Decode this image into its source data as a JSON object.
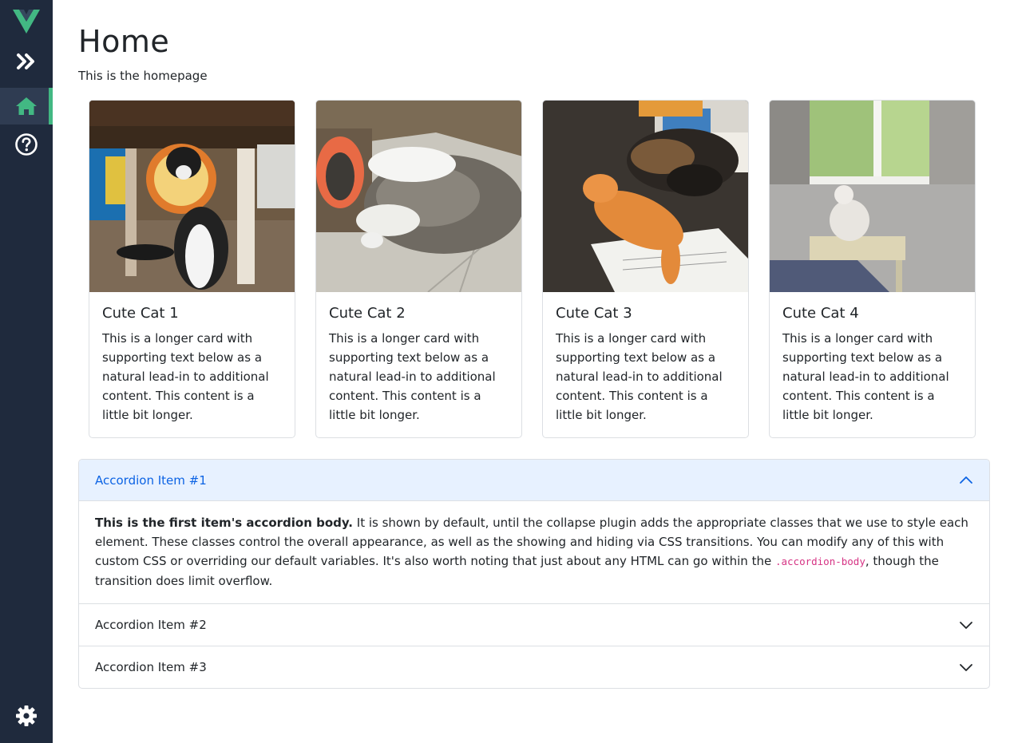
{
  "sidebar": {
    "logo": "vue-logo",
    "items": [
      {
        "icon": "double-chevron-right-icon",
        "label": "Expand"
      },
      {
        "icon": "home-icon",
        "label": "Home",
        "active": true
      },
      {
        "icon": "help-circle-icon",
        "label": "Help"
      },
      {
        "icon": "gear-icon",
        "label": "Settings"
      }
    ]
  },
  "page": {
    "title": "Home",
    "subtitle": "This is the homepage"
  },
  "cards": [
    {
      "title": "Cute Cat 1",
      "text": "This is a longer card with supporting text below as a natural lead-in to additional content. This content is a little bit longer."
    },
    {
      "title": "Cute Cat 2",
      "text": "This is a longer card with supporting text below as a natural lead-in to additional content. This content is a little bit longer."
    },
    {
      "title": "Cute Cat 3",
      "text": "This is a longer card with supporting text below as a natural lead-in to additional content. This content is a little bit longer."
    },
    {
      "title": "Cute Cat 4",
      "text": "This is a longer card with supporting text below as a natural lead-in to additional content. This content is a little bit longer."
    }
  ],
  "accordion": {
    "items": [
      {
        "label": "Accordion Item #1",
        "open": true
      },
      {
        "label": "Accordion Item #2",
        "open": false
      },
      {
        "label": "Accordion Item #3",
        "open": false
      }
    ],
    "body": {
      "strong": "This is the first item's accordion body.",
      "text_before": " It is shown by default, until the collapse plugin adds the appropriate classes that we use to style each element. These classes control the overall appearance, as well as the showing and hiding via CSS transitions. You can modify any of this with custom CSS or overriding our default variables. It's also worth noting that just about any HTML can go within the ",
      "code": ".accordion-body",
      "text_after": ", though the transition does limit overflow."
    }
  },
  "colors": {
    "sidebar_bg": "#1f2a3d",
    "accent": "#42b883",
    "accordion_active_bg": "#e7f1ff",
    "accordion_active_text": "#0c63e4"
  }
}
